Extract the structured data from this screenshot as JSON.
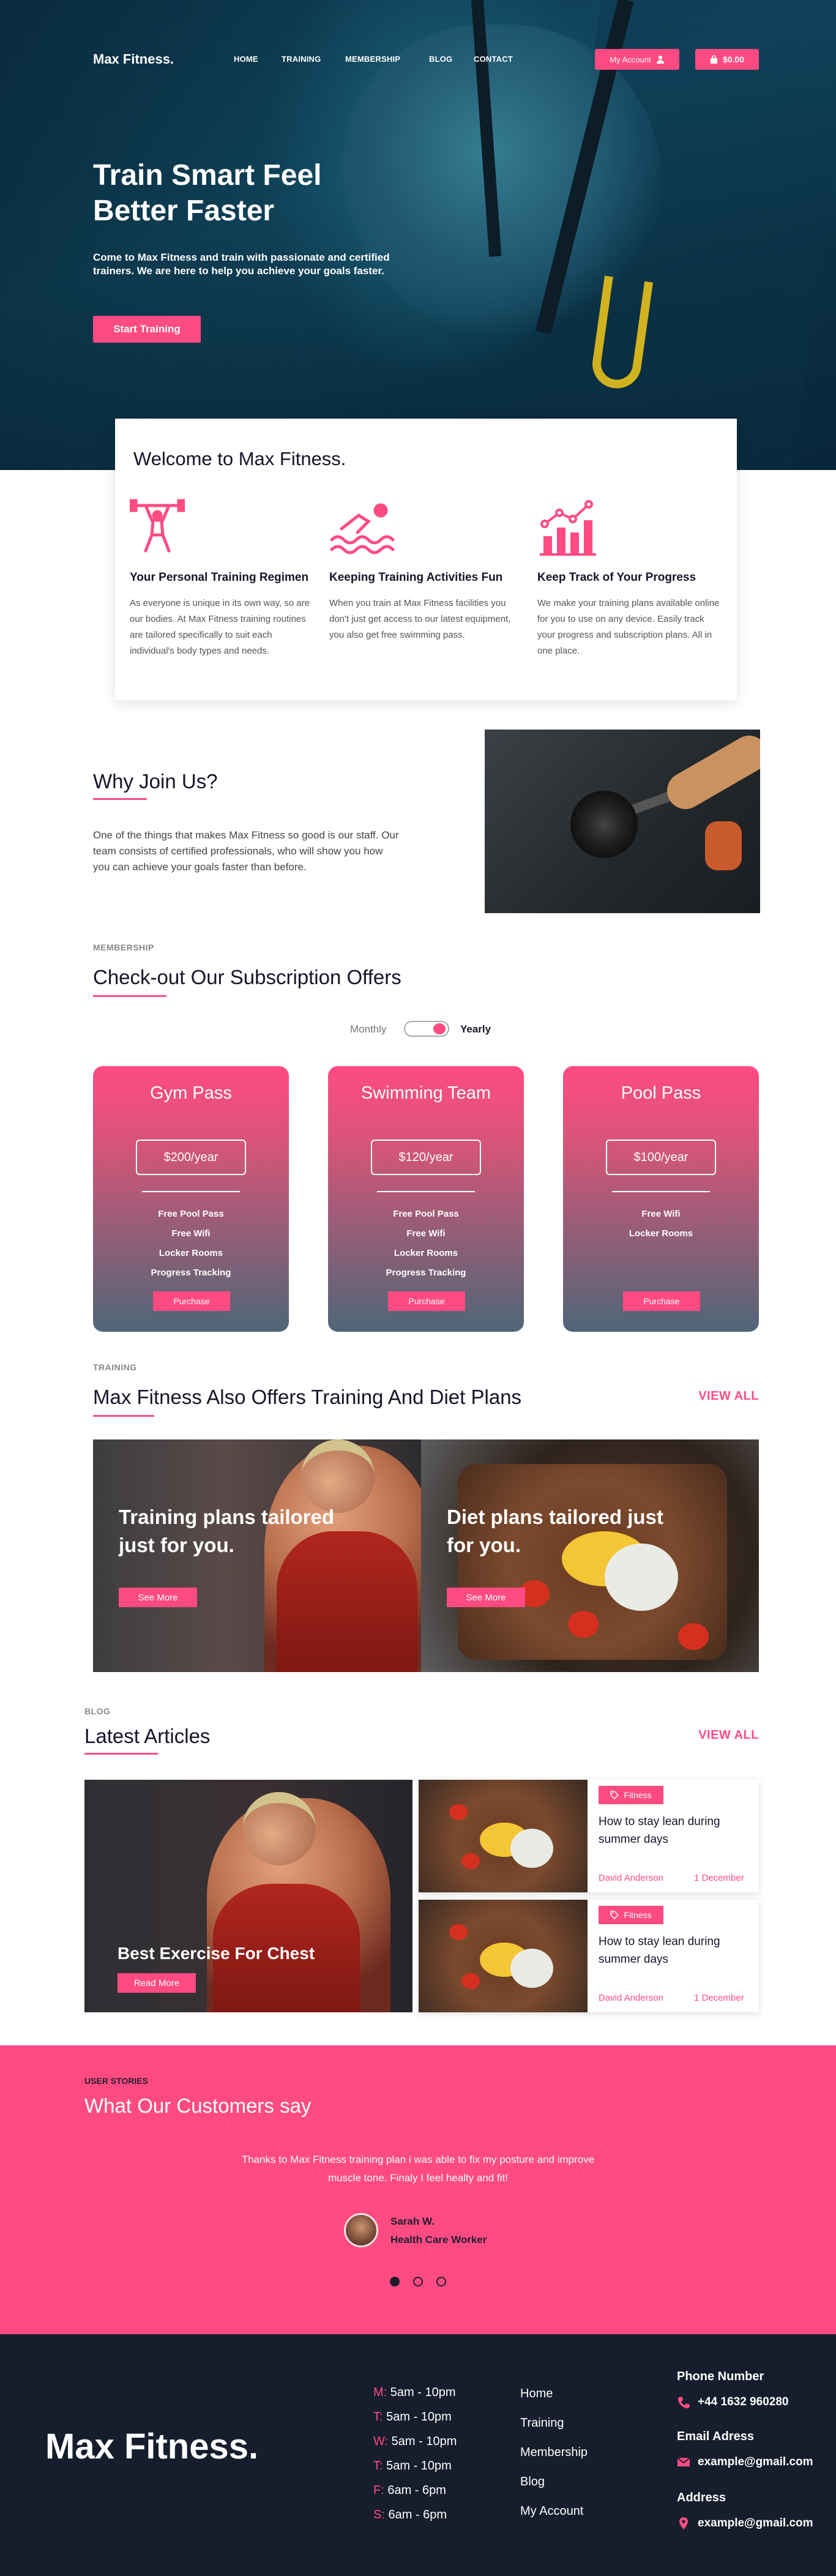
{
  "nav": {
    "logo": "Max Fitness.",
    "links": [
      "HOME",
      "TRAINING",
      "MEMBERSHIP",
      "BLOG",
      "CONTACT"
    ],
    "account_label": "My Account",
    "cart_label": "$0.00"
  },
  "hero": {
    "title_line1": "Train Smart Feel",
    "title_line2": "Better Faster",
    "lead": "Come to Max Fitness and train with passionate and certified trainers. We are here to help you achieve your goals faster.",
    "cta": "Start Training"
  },
  "welcome": {
    "title": "Welcome to Max Fitness.",
    "features": [
      {
        "icon": "weightlifter-icon",
        "title": "Your Personal Training Regimen",
        "text": "As everyone is unique in its own way, so are our bodies. At Max Fitness training routines are tailored specifically to suit each individual's body types and needs."
      },
      {
        "icon": "swimmer-icon",
        "title": "Keeping Training Activities Fun",
        "text": "When you train at Max Fitness facilities you don't just get access to our latest equipment, you also get free swimming pass."
      },
      {
        "icon": "progress-chart-icon",
        "title": "Keep Track of Your Progress",
        "text": "We make your training plans available online  for you to use on any device. Easily track your progress and subscription plans. All in one place."
      }
    ]
  },
  "why": {
    "title": "Why Join Us?",
    "text": "One of the things that makes Max Fitness so good is our staff. Our team consists of certified professionals, who will show you how you can achieve your goals faster than before."
  },
  "membership": {
    "eyebrow": "MEMBERSHIP",
    "title": "Check-out Our Subscription Offers",
    "toggle_left": "Monthly",
    "toggle_right": "Yearly",
    "toggle_selected": "Yearly",
    "plans": [
      {
        "name": "Gym Pass",
        "price": "$200/year",
        "features": [
          "Free Pool Pass",
          "Free Wifi",
          "Locker Rooms",
          "Progress Tracking"
        ],
        "button": "Purchase"
      },
      {
        "name": "Swimming Team",
        "price": "$120/year",
        "features": [
          "Free Pool Pass",
          "Free Wifi",
          "Locker Rooms",
          "Progress Tracking"
        ],
        "button": "Purchase"
      },
      {
        "name": "Pool Pass",
        "price": "$100/year",
        "features": [
          "Free Wifi",
          "Locker Rooms"
        ],
        "button": "Purchase"
      }
    ]
  },
  "training": {
    "eyebrow": "TRAINING",
    "title": "Max Fitness Also Offers Training And Diet Plans",
    "view_all": "VIEW ALL",
    "cards": [
      {
        "title": "Training plans tailored just for you.",
        "button": "See More"
      },
      {
        "title": "Diet plans tailored just for you.",
        "button": "See More"
      }
    ]
  },
  "blog": {
    "eyebrow": "BLOG",
    "title": "Latest Articles",
    "view_all": "VIEW ALL",
    "featured": {
      "title": "Best Exercise For Chest",
      "button": "Read More"
    },
    "posts": [
      {
        "tag": "Fitness",
        "title": "How to stay lean during summer days",
        "author": "David Anderson",
        "date": "1 December"
      },
      {
        "tag": "Fitness",
        "title": "How to stay lean during summer days",
        "author": "David Anderson",
        "date": "1 December"
      }
    ]
  },
  "testimonials": {
    "eyebrow": "USER STORIES",
    "title": "What Our Customers say",
    "quote": "Thanks to Max Fitness training plan i was able to fix my posture and improve muscle tone. Finaly I feel healty and fit!",
    "name": "Sarah W.",
    "role": "Health Care Worker",
    "active_dot": 1,
    "dot_count": 3
  },
  "footer": {
    "logo": "Max Fitness.",
    "hours": [
      {
        "day": "M:",
        "time": "5am - 10pm"
      },
      {
        "day": "T:",
        "time": "5am - 10pm"
      },
      {
        "day": "W:",
        "time": "5am - 10pm"
      },
      {
        "day": "T:",
        "time": "5am - 10pm"
      },
      {
        "day": "F:",
        "time": "6am - 6pm"
      },
      {
        "day": "S:",
        "time": "6am - 6pm"
      }
    ],
    "links": [
      "Home",
      "Training",
      "Membership",
      "Blog",
      "My Account"
    ],
    "phone_label": "Phone Number",
    "phone": "+44 1632 960280",
    "email_label": "Email Adress",
    "email": "example@gmail.com",
    "address_label": "Address",
    "address": "example@gmail.com"
  },
  "colors": {
    "accent": "#ff4b82",
    "footer_bg": "#161d2c",
    "plan_gradient_bottom": "#4f6677"
  }
}
